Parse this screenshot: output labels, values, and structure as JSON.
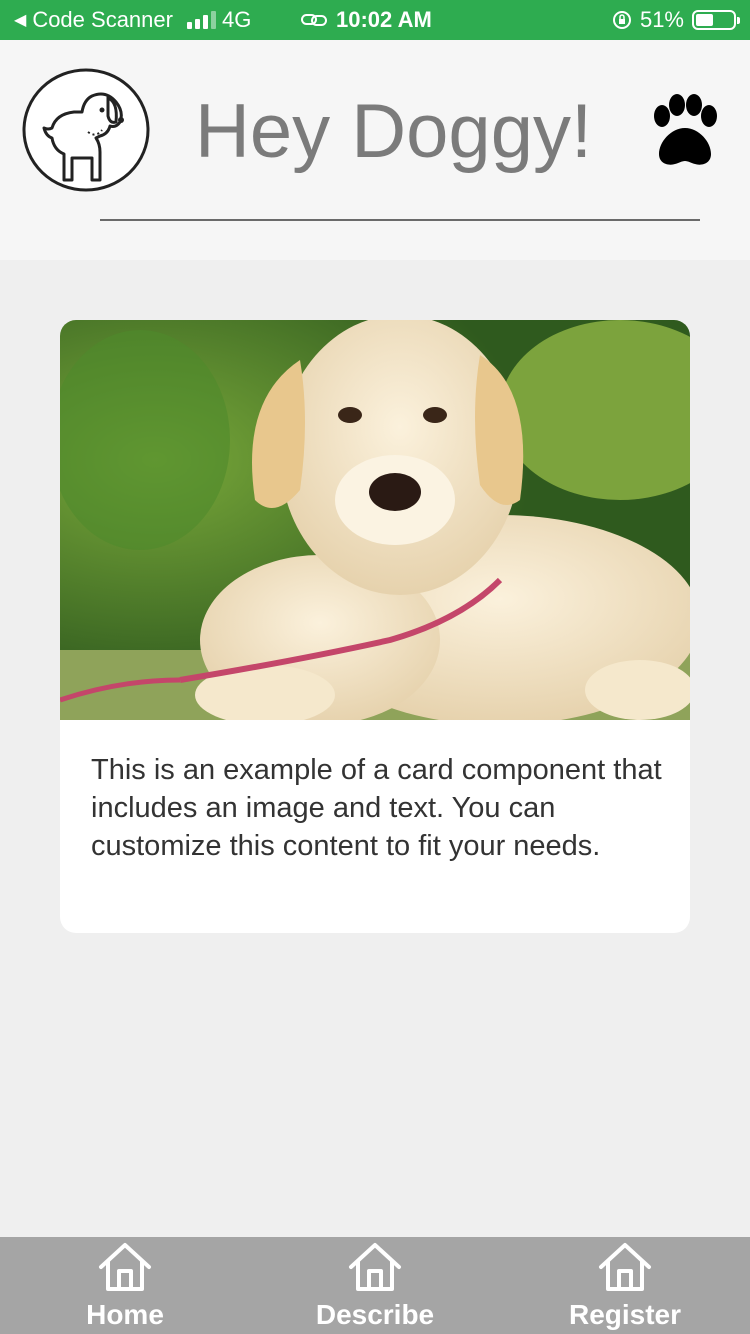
{
  "status_bar": {
    "back_app": "Code Scanner",
    "network": "4G",
    "time": "10:02 AM",
    "battery": "51%"
  },
  "header": {
    "title": "Hey Doggy!",
    "logo_icon": "dog-icon",
    "paw_icon": "paw-icon"
  },
  "card": {
    "image": "puppy-photo",
    "text": "This is an example of a card component that includes an image and text. You can customize this content to fit your needs."
  },
  "tabs": [
    {
      "label": "Home",
      "icon": "home-icon"
    },
    {
      "label": "Describe",
      "icon": "home-icon"
    },
    {
      "label": "Register",
      "icon": "home-icon"
    }
  ],
  "colors": {
    "status_bar": "#2eac50",
    "tab_bar": "#a5a5a5",
    "title": "#7b7b7b",
    "background": "#efefef"
  }
}
